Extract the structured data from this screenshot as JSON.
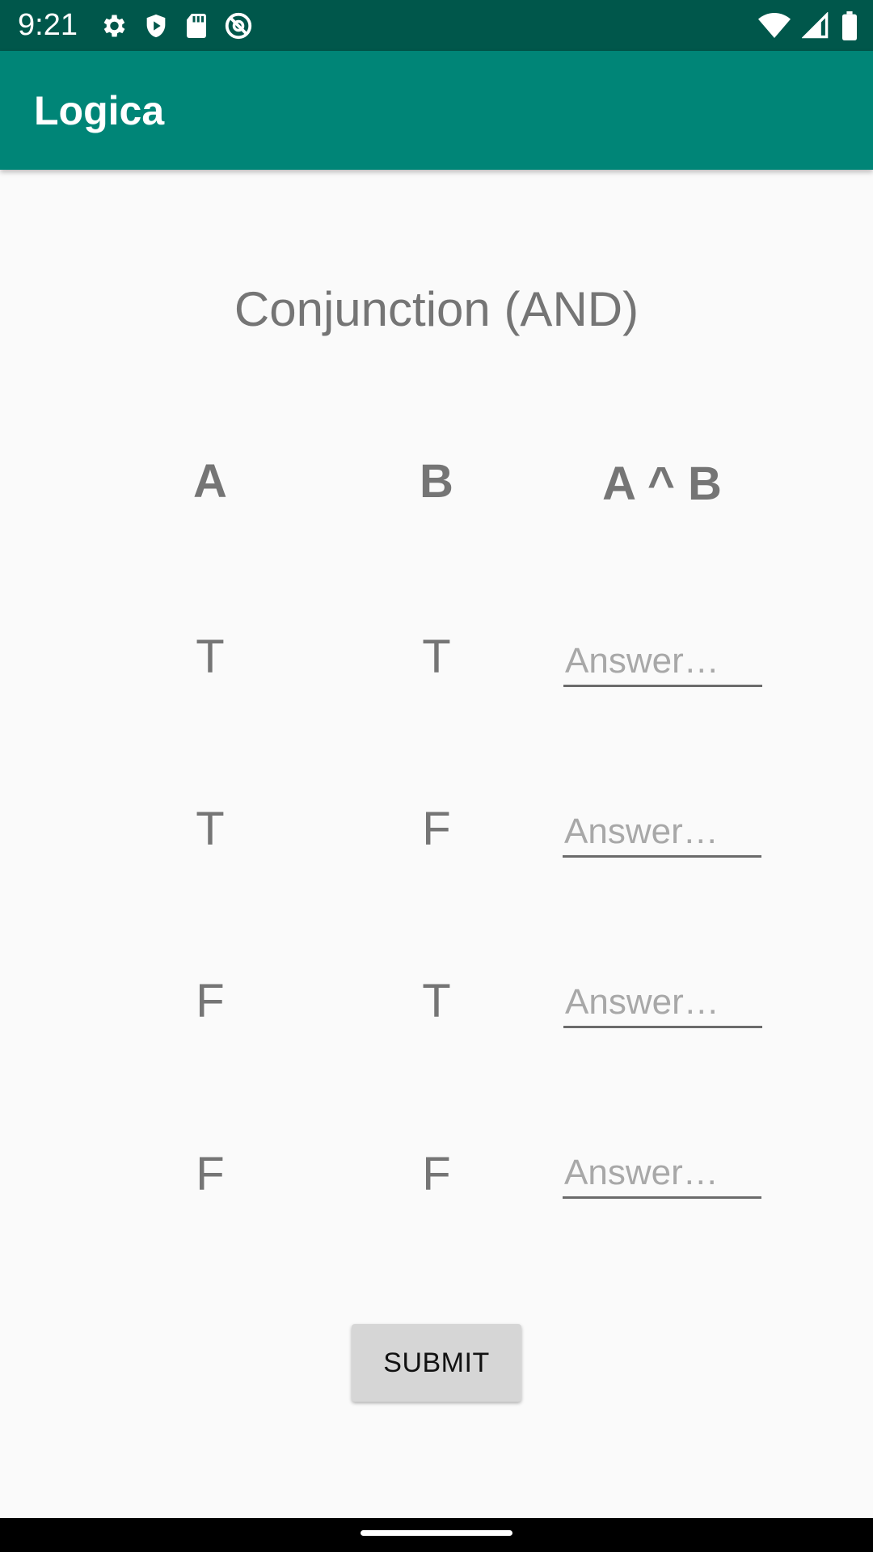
{
  "status_bar": {
    "time": "9:21",
    "left_icons": [
      "settings-icon",
      "shield-play-icon",
      "sd-card-icon",
      "no-tracking-icon"
    ],
    "right_icons": [
      "wifi-icon",
      "cell-signal-icon",
      "battery-icon"
    ]
  },
  "app_bar": {
    "title": "Logica"
  },
  "main": {
    "heading": "Conjunction (AND)",
    "columns": {
      "a": "A",
      "b": "B",
      "result": "A ^ B"
    },
    "rows": [
      {
        "a": "T",
        "b": "T",
        "answer_value": "",
        "answer_placeholder": "Answer…"
      },
      {
        "a": "T",
        "b": "F",
        "answer_value": "",
        "answer_placeholder": "Answer…"
      },
      {
        "a": "F",
        "b": "T",
        "answer_value": "",
        "answer_placeholder": "Answer…"
      },
      {
        "a": "F",
        "b": "F",
        "answer_value": "",
        "answer_placeholder": "Answer…"
      }
    ],
    "submit_label": "SUBMIT"
  },
  "colors": {
    "status_bar": "#00574b",
    "app_bar": "#008577",
    "background": "#fafafa",
    "text_gray": "#757575",
    "button": "#d6d6d6"
  }
}
